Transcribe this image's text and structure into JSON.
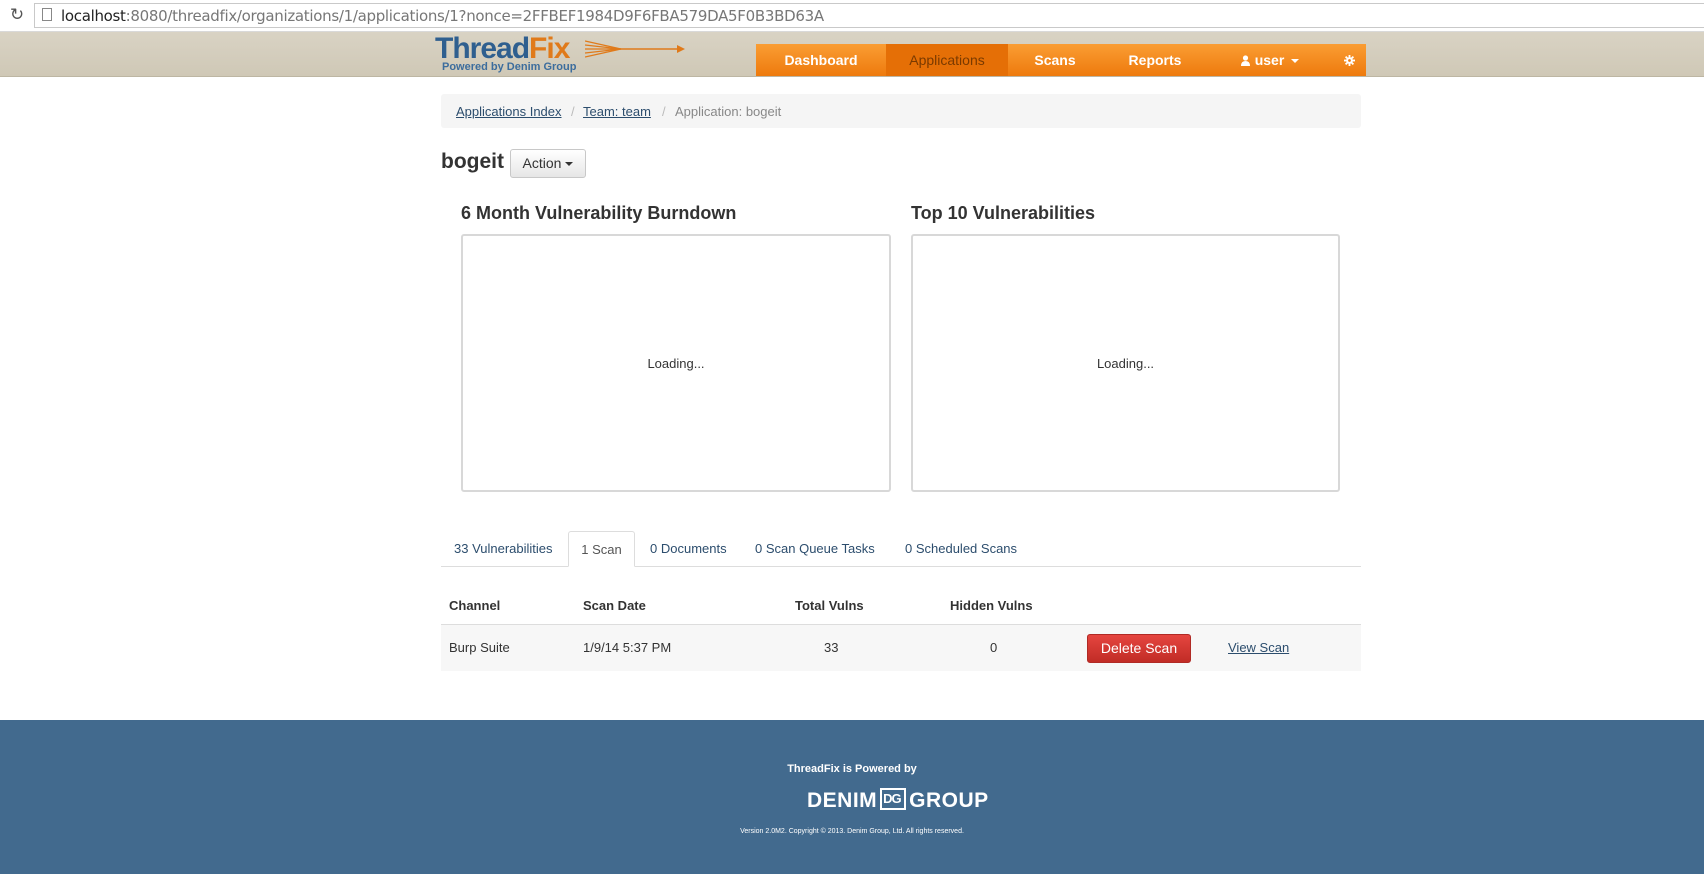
{
  "browser": {
    "url_host": "localhost",
    "url_rest": ":8080/threadfix/organizations/1/applications/1?nonce=2FFBEF1984D9F6FBA579DA5F0B3BD63A"
  },
  "brand": {
    "name_part1": "Thread",
    "name_part2": "Fix",
    "tagline": "Powered by Denim Group"
  },
  "nav": {
    "items": [
      "Dashboard",
      "Applications",
      "Scans",
      "Reports"
    ],
    "user_label": "user",
    "active": "Applications"
  },
  "breadcrumb": {
    "items": [
      "Applications Index",
      "Team: team",
      "Application: bogeit"
    ],
    "separator": "/"
  },
  "app": {
    "title": "bogeit",
    "action_label": "Action"
  },
  "panels": {
    "burndown_title": "6 Month Vulnerability Burndown",
    "top10_title": "Top 10 Vulnerabilities",
    "loading_text": "Loading..."
  },
  "tabs": [
    "33 Vulnerabilities",
    "1 Scan",
    "0 Documents",
    "0 Scan Queue Tasks",
    "0 Scheduled Scans"
  ],
  "scan_table": {
    "headers": [
      "Channel",
      "Scan Date",
      "Total Vulns",
      "Hidden Vulns"
    ],
    "rows": [
      {
        "channel": "Burp Suite",
        "date": "1/9/14 5:37 PM",
        "total": "33",
        "hidden": "0",
        "delete_label": "Delete Scan",
        "view_label": "View Scan"
      }
    ]
  },
  "footer": {
    "powered_by": "ThreadFix is Powered by",
    "logo_left": "DENIM",
    "logo_mark": "DG",
    "logo_right": "GROUP",
    "copyright": "Version 2.0M2. Copyright © 2013. Denim Group, Ltd. All rights reserved."
  },
  "colors": {
    "nav_orange": "#f08a1c",
    "footer_blue": "#426a8e",
    "danger_red": "#d33b35",
    "header_tan": "#d5cfbf"
  }
}
